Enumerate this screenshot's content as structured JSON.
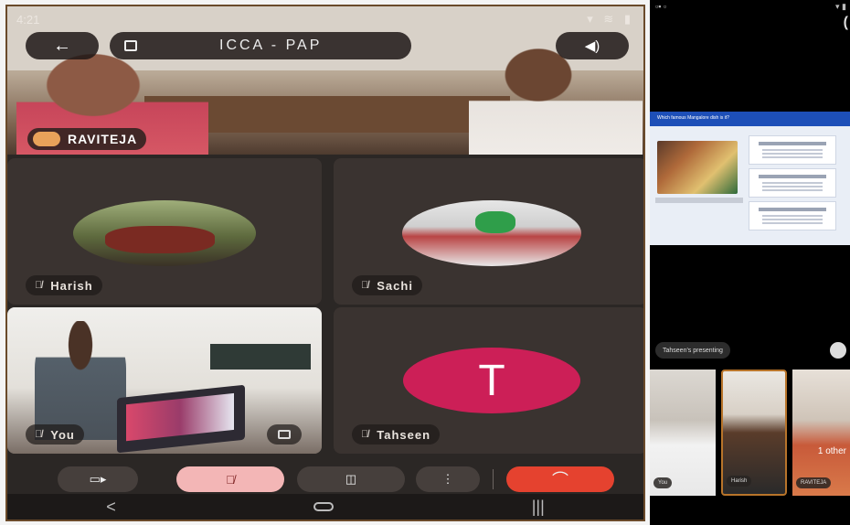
{
  "left_call": {
    "status_time": "4:21",
    "meeting_title": "ICCA - PAP",
    "active_speaker": "RAVITEJA",
    "participants": [
      {
        "name": "Harish"
      },
      {
        "name": "Sachi"
      },
      {
        "name": "You"
      },
      {
        "name": "Tahseen",
        "initial": "T"
      }
    ],
    "back_symbol": "←",
    "audio_symbol": "◀)",
    "controls": {
      "camera": "▭▸",
      "mic": "🎙̸",
      "captions": "◫",
      "more": "⋮",
      "end": "⌒"
    },
    "nav": {
      "back": "<",
      "recents": "|||"
    },
    "accent_end_color": "#e5422f",
    "avatar_t_color": "#cc1f57"
  },
  "right_call": {
    "presenting_label": "Tahseen's presenting",
    "shared_question": "Which famous Mangalore dish is it?",
    "thumbs": [
      {
        "label": "You"
      },
      {
        "label": "Harish"
      },
      {
        "label": "RAVITEJA",
        "extra": "1 other"
      }
    ]
  }
}
